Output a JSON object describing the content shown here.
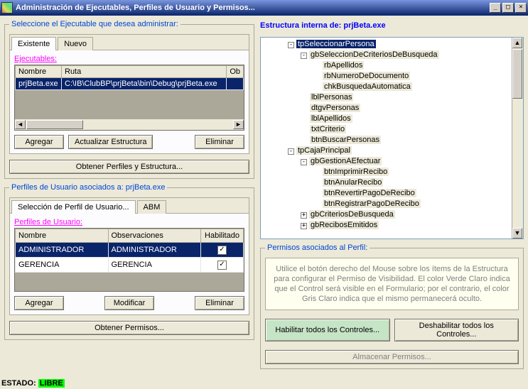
{
  "window": {
    "title": "Administración de Ejecutables, Perfiles de Usuario y Permisos..."
  },
  "left": {
    "group1_legend": "Seleccione el Ejecutable que desea administrar:",
    "tabs": {
      "existente": "Existente",
      "nuevo": "Nuevo"
    },
    "ejec_label": "Ejecutables:",
    "ejec_cols": {
      "nombre": "Nombre",
      "ruta": "Ruta",
      "ob": "Ob"
    },
    "ejec_row": {
      "nombre": "prjBeta.exe",
      "ruta": "C:\\IB\\ClubBP\\prjBeta\\bin\\Debug\\prjBeta.exe"
    },
    "btns1": {
      "agregar": "Agregar",
      "actualizar": "Actualizar Estructura",
      "eliminar": "Eliminar"
    },
    "btn_obtener1": "Obtener Perfiles y Estructura...",
    "group2_legend": "Perfiles de Usuario asociados a: prjBeta.exe",
    "tabs2": {
      "sel": "Selección de Perfil de Usuario...",
      "abm": "ABM"
    },
    "perf_label": "Perfiles de Usuario:",
    "perf_cols": {
      "nombre": "Nombre",
      "obs": "Observaciones",
      "hab": "Habilitado"
    },
    "perf_rows": [
      {
        "nombre": "ADMINISTRADOR",
        "obs": "ADMINISTRADOR",
        "hab": "✓"
      },
      {
        "nombre": "GERENCIA",
        "obs": "GERENCIA",
        "hab": "✓"
      }
    ],
    "btns2": {
      "agregar": "Agregar",
      "modificar": "Modificar",
      "eliminar": "Eliminar"
    },
    "btn_obtener2": "Obtener Permisos..."
  },
  "right": {
    "title_prefix": "Estructura interna de:  ",
    "title_file": "prjBeta.exe",
    "tree": {
      "n0": "tpSeleccionarPersona",
      "n0_0": "gbSeleccionDeCriteriosDeBusqueda",
      "n0_0_0": "rbApellidos",
      "n0_0_1": "rbNumeroDeDocumento",
      "n0_0_2": "chkBusquedaAutomatica",
      "n0_1": "lblPersonas",
      "n0_2": "dtgvPersonas",
      "n0_3": "lblApellidos",
      "n0_4": "txtCriterio",
      "n0_5": "btnBuscarPersonas",
      "n1": "tpCajaPrincipal",
      "n1_0": "gbGestionAEfectuar",
      "n1_0_0": "btnImprimirRecibo",
      "n1_0_1": "btnAnularRecibo",
      "n1_0_2": "btnRevertirPagoDeRecibo",
      "n1_0_3": "btnRegistrarPagoDeRecibo",
      "n1_1": "gbCriteriosDeBusqueda",
      "n1_2": "gbRecibosEmitidos"
    },
    "perm_legend": "Permisos asociados al Perfil:",
    "perm_text": "Utilice el botón derecho del Mouse sobre los ítems de la Estructura para configurar el Permiso de Visibilidad. El color Verde Claro indica que el Control será visible en el Formulario; por el contrario, el color Gris Claro indica que el mismo permanecerá oculto.",
    "btn_hab": "Habilitar todos los Controles...",
    "btn_deshab": "Deshabilitar todos los Controles...",
    "btn_almacenar": "Almacenar Permisos..."
  },
  "status": {
    "label": "ESTADO: ",
    "value": "LIBRE"
  }
}
